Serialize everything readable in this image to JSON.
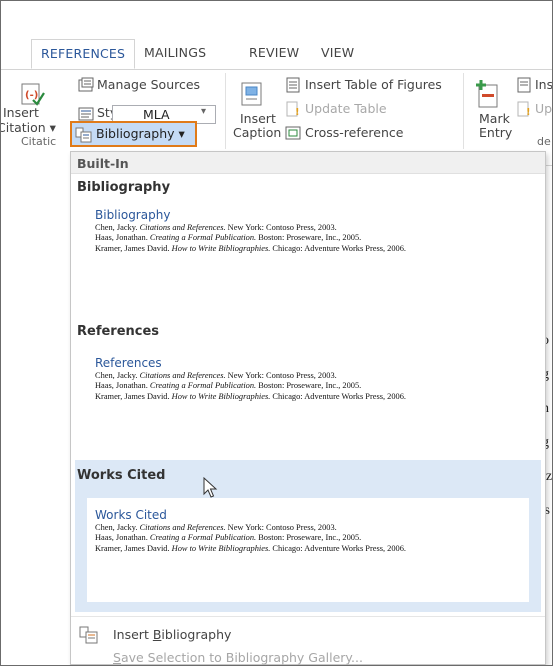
{
  "tabs": [
    {
      "label": "REFERENCES",
      "active": true
    },
    {
      "label": "MAILINGS",
      "active": false
    },
    {
      "label": "REVIEW",
      "active": false
    },
    {
      "label": "VIEW",
      "active": false
    }
  ],
  "ribbon": {
    "insert_citation": {
      "line1": "Insert",
      "line2": "Citation ▾"
    },
    "manage_sources": "Manage Sources",
    "style_label": "Style:",
    "style_value": "MLA",
    "bibliography_button": "Bibliography ▾",
    "group_citations": "Citatic",
    "insert_caption": {
      "line1": "Insert",
      "line2": "Caption"
    },
    "insert_table_of_figures": "Insert Table of Figures",
    "update_table": "Update Table",
    "cross_reference": "Cross-reference",
    "mark_entry": {
      "line1": "Mark",
      "line2": "Entry"
    },
    "insert_index_partial": "Ins",
    "update_index_partial": "Up",
    "group_index_partial": "de"
  },
  "dropdown": {
    "section_builtin": "Built-In",
    "galleries": [
      {
        "gallery_title": "Bibliography",
        "preview_title": "Bibliography",
        "lines": [
          "Chen, Jacky. Citations and References. New York: Contoso Press, 2003.",
          "Haas, Jonathan. Creating a Formal Publication. Boston: Proseware, Inc., 2005.",
          "Kramer, James David. How to Write Bibliographies. Chicago: Adventure Works Press, 2006."
        ]
      },
      {
        "gallery_title": "References",
        "preview_title": "References",
        "lines": [
          "Chen, Jacky. Citations and References. New York: Contoso Press, 2003.",
          "Haas, Jonathan. Creating a Formal Publication. Boston: Proseware, Inc., 2005.",
          "Kramer, James David. How to Write Bibliographies. Chicago: Adventure Works Press, 2006."
        ]
      },
      {
        "gallery_title": "Works Cited",
        "preview_title": "Works Cited",
        "lines": [
          "Chen, Jacky. Citations and References. New York: Contoso Press, 2003.",
          "Haas, Jonathan. Creating a Formal Publication. Boston: Proseware, Inc., 2005.",
          "Kramer, James David. How to Write Bibliographies. Chicago: Adventure Works Press, 2006."
        ]
      }
    ],
    "insert_bibliography": {
      "pre": "Insert ",
      "key": "B",
      "post": "ibliography"
    },
    "save_selection": {
      "pre": "",
      "key": "S",
      "post": "ave Selection to Bibliography Gallery..."
    }
  },
  "document_fragments": [
    "o",
    "g",
    "h",
    "g",
    "iz",
    "'s"
  ],
  "colors": {
    "accent": "#2b579a",
    "highlight_border": "#e07b19",
    "hover": "#dce8f6"
  }
}
